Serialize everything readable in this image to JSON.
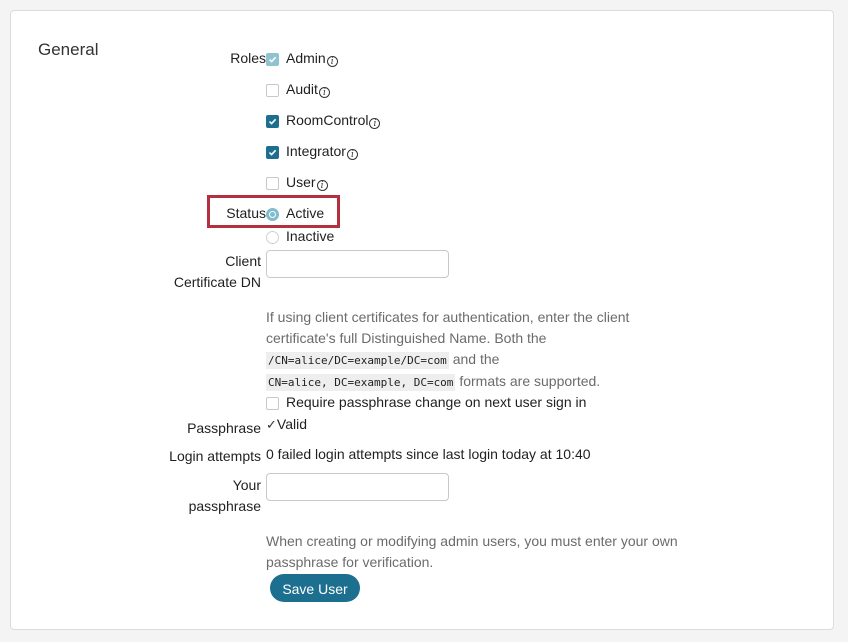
{
  "section": {
    "title": "General"
  },
  "roles": {
    "label": "Roles",
    "items": [
      {
        "name": "Admin",
        "checked": true,
        "disabled": true
      },
      {
        "name": "Audit",
        "checked": false
      },
      {
        "name": "RoomControl",
        "checked": true
      },
      {
        "name": "Integrator",
        "checked": true
      },
      {
        "name": "User",
        "checked": false
      }
    ],
    "info_glyph": "i"
  },
  "status": {
    "label": "Status",
    "options": [
      {
        "name": "Active",
        "selected": true
      },
      {
        "name": "Inactive",
        "selected": false
      }
    ]
  },
  "client_cert": {
    "label_line1": "Client",
    "label_line2": "Certificate DN",
    "value": "",
    "help_line1": "If using client certificates for authentication, enter the client",
    "help_line2": "certificate's full Distinguished Name. Both the",
    "example1": "/CN=alice/DC=example/DC=com",
    "help_and": "and the",
    "example2": "CN=alice, DC=example, DC=com",
    "help_tail": "formats are supported."
  },
  "require_change": {
    "label": "Require passphrase change on next user sign in",
    "checked": false
  },
  "passphrase": {
    "label": "Passphrase",
    "check_glyph": "✓",
    "status": "Valid"
  },
  "login_attempts": {
    "label": "Login attempts",
    "value": "0 failed login attempts since last login today at 10:40"
  },
  "your_passphrase": {
    "label_line1": "Your",
    "label_line2": "passphrase",
    "value": "",
    "help_line1": "When creating or modifying admin users, you must enter your own",
    "help_line2": "passphrase for verification."
  },
  "save_button": {
    "label": "Save User"
  },
  "colors": {
    "accent": "#1d6f8f",
    "highlight": "#b5303e",
    "help_text": "#6b6b6b"
  }
}
